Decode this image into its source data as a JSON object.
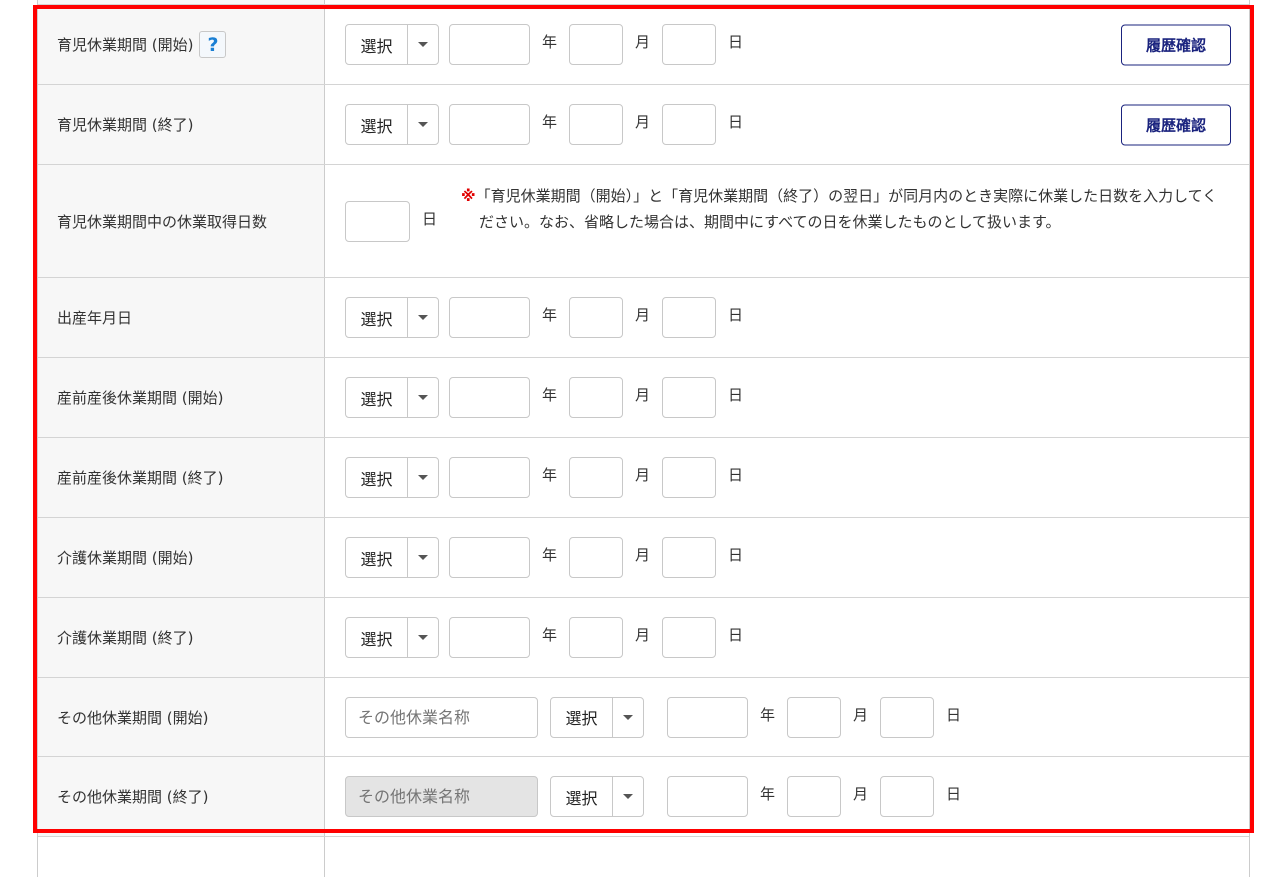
{
  "select_label": "選択",
  "units": {
    "year": "年",
    "month": "月",
    "day": "日"
  },
  "history_button": "履歴確認",
  "help_icon": "?",
  "rows": [
    {
      "label": "育児休業期間 (開始)"
    },
    {
      "label": "育児休業期間 (終了)"
    },
    {
      "label": "育児休業期間中の休業取得日数"
    },
    {
      "label": "出産年月日"
    },
    {
      "label": "産前産後休業期間 (開始)"
    },
    {
      "label": "産前産後休業期間 (終了)"
    },
    {
      "label": "介護休業期間 (開始)"
    },
    {
      "label": "介護休業期間 (終了)"
    },
    {
      "label": "その他休業期間 (開始)"
    },
    {
      "label": "その他休業期間 (終了)"
    }
  ],
  "note_mark": "※",
  "note_text": "「育児休業期間（開始）」と「育児休業期間（終了）の翌日」が同月内のとき実際に休業した日数を入力してください。なお、省略した場合は、期間中にすべての日を休業したものとして扱います。",
  "other_name_placeholder": "その他休業名称"
}
